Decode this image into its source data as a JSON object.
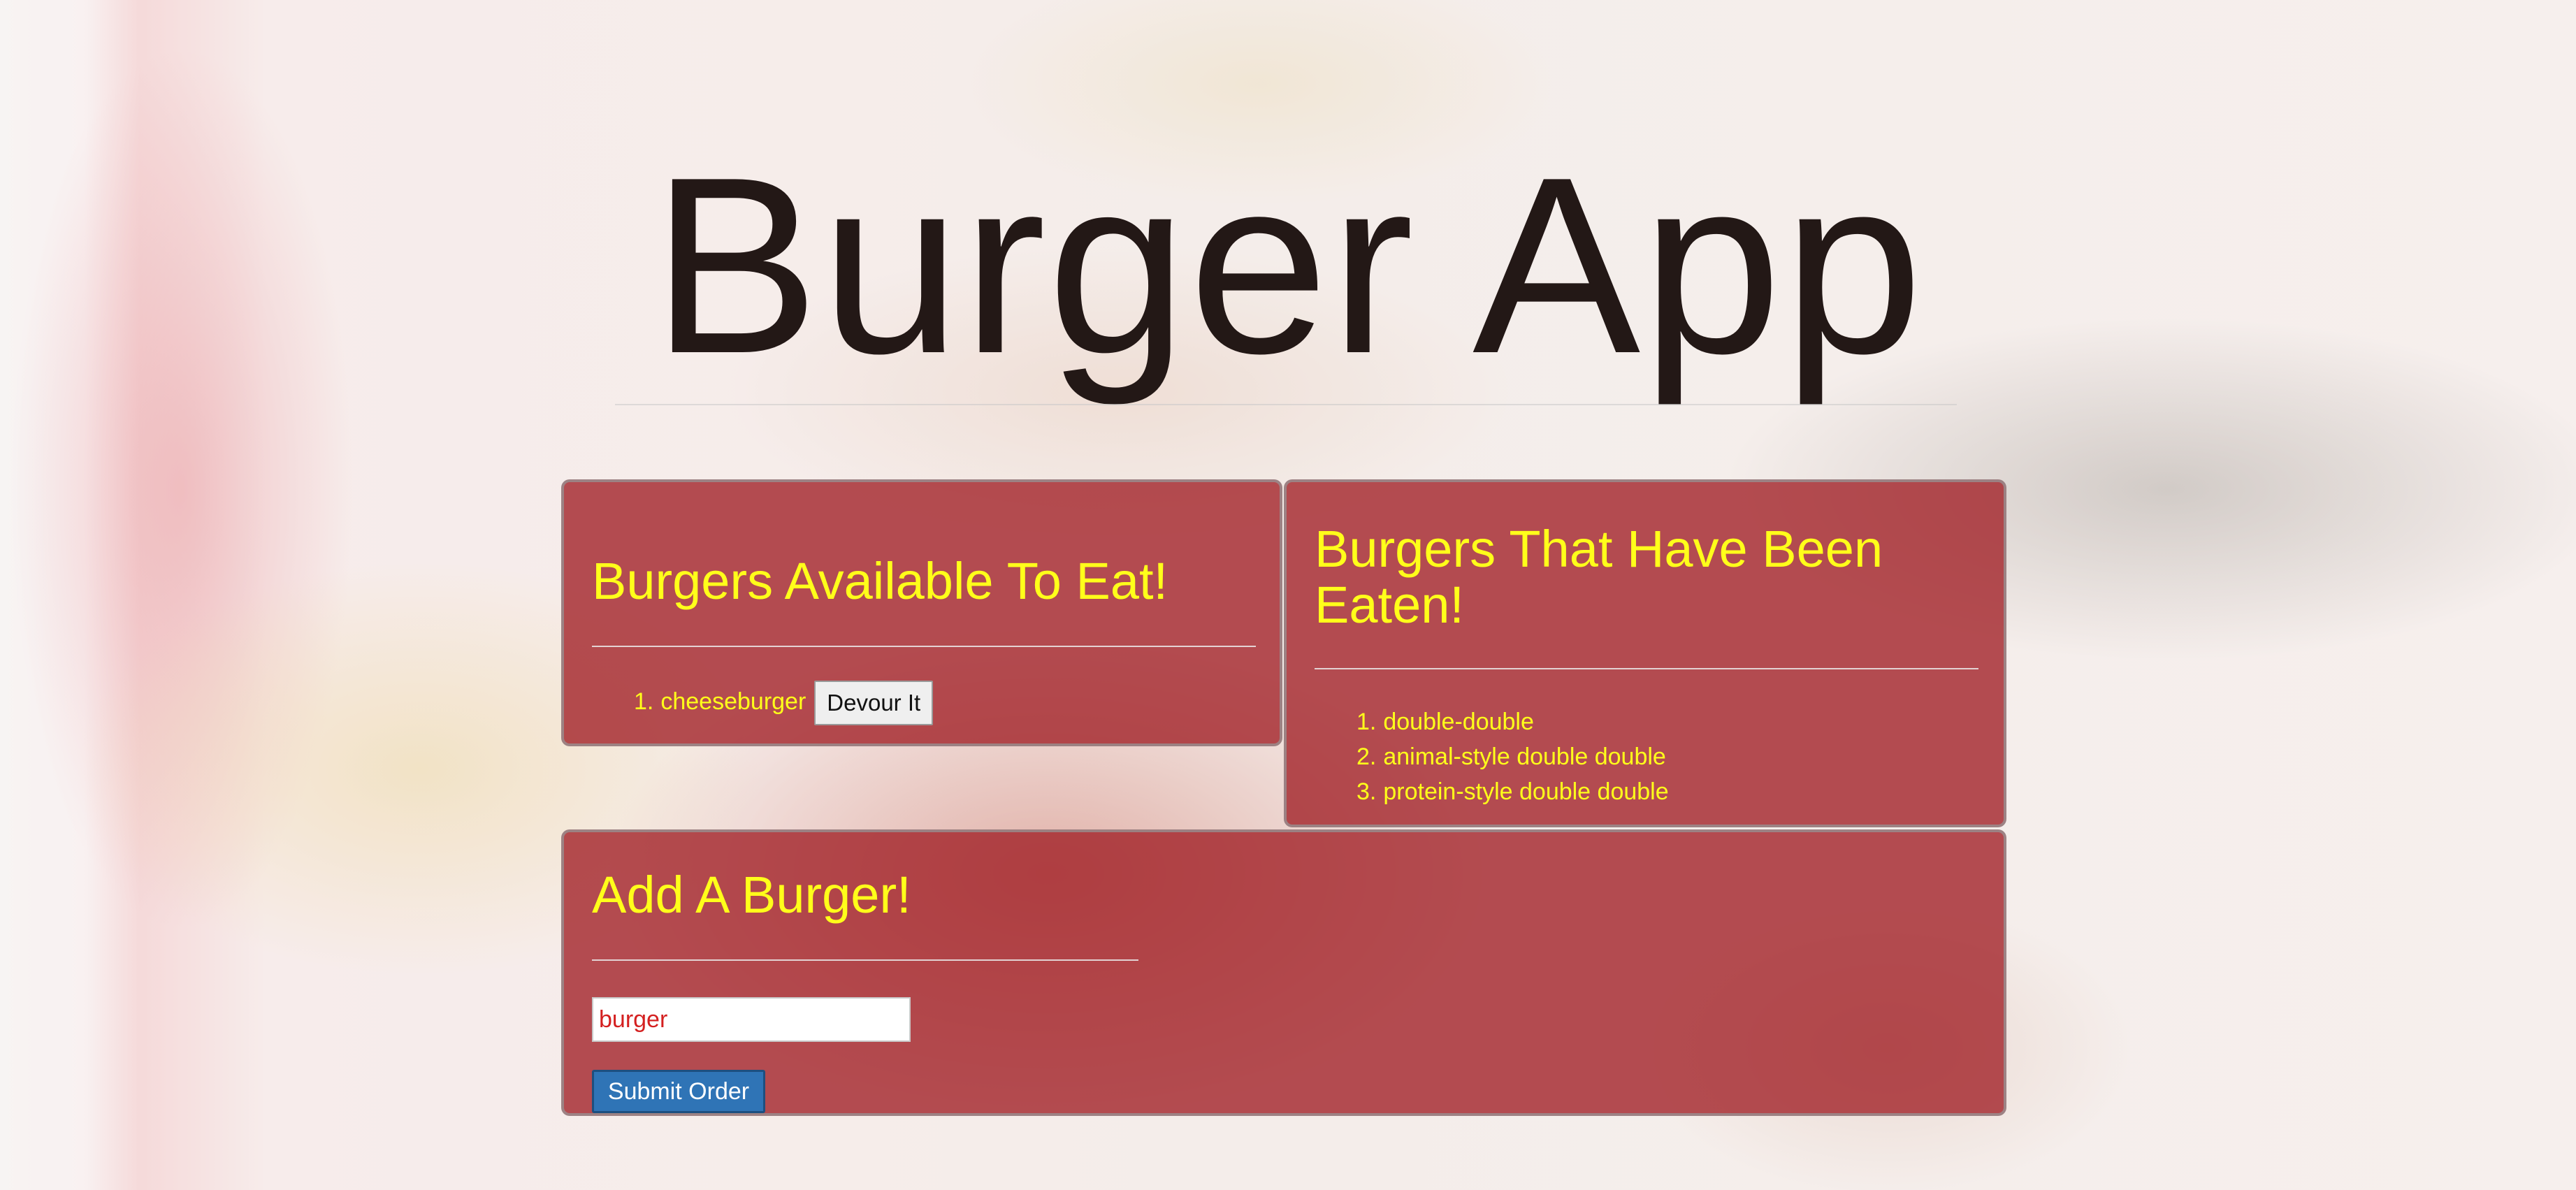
{
  "app": {
    "title": "Burger App"
  },
  "available": {
    "heading": "Burgers Available To Eat!",
    "items": [
      {
        "number": "1.",
        "name": "cheeseburger",
        "button_label": "Devour It"
      }
    ]
  },
  "eaten": {
    "heading_line1": "Burgers That Have Been",
    "heading_line2": "Eaten!",
    "items": [
      {
        "number": "1.",
        "name": "double-double"
      },
      {
        "number": "2.",
        "name": "animal-style double double"
      },
      {
        "number": "3.",
        "name": "protein-style double double"
      }
    ]
  },
  "add": {
    "heading": "Add A Burger!",
    "input_value": "burger",
    "submit_label": "Submit Order"
  },
  "colors": {
    "heading_text": "#ffff1a",
    "panel_bg": "#a01e24",
    "submit_button": "#2f74b6",
    "input_text": "#d42020"
  }
}
